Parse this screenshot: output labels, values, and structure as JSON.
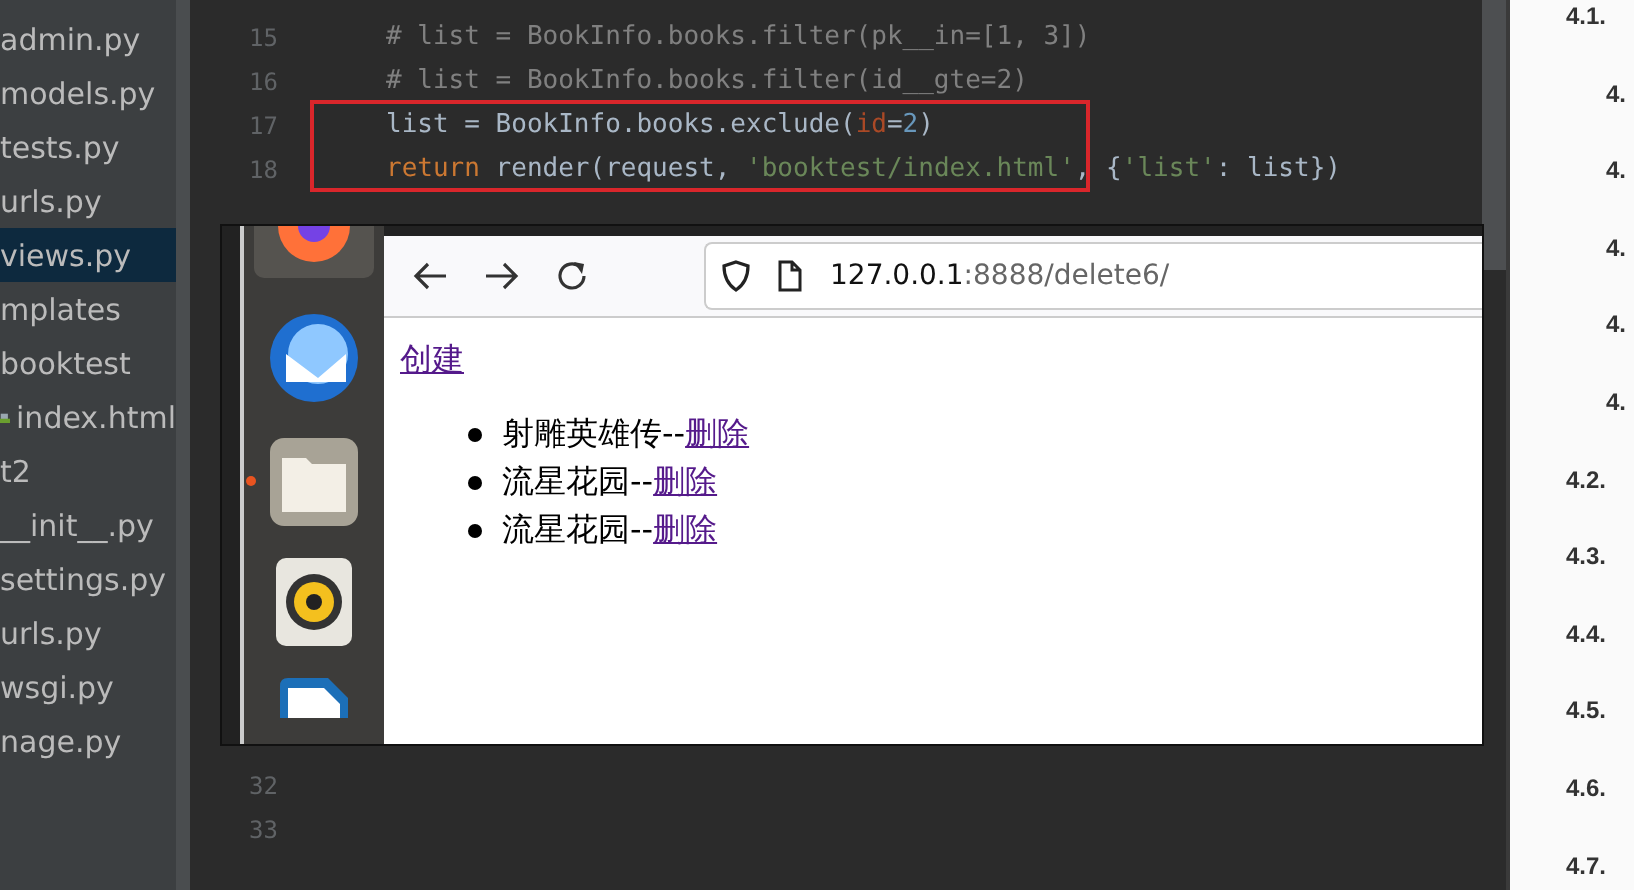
{
  "project_tree": {
    "items": [
      {
        "label": "admin.py",
        "selected": false,
        "kind": "file"
      },
      {
        "label": "models.py",
        "selected": false,
        "kind": "file"
      },
      {
        "label": "tests.py",
        "selected": false,
        "kind": "file"
      },
      {
        "label": "urls.py",
        "selected": false,
        "kind": "file"
      },
      {
        "label": "views.py",
        "selected": true,
        "kind": "file"
      },
      {
        "label": "mplates",
        "selected": false,
        "kind": "file"
      },
      {
        "label": "booktest",
        "selected": false,
        "kind": "file"
      },
      {
        "label": "index.html",
        "selected": false,
        "kind": "html"
      },
      {
        "label": "t2",
        "selected": false,
        "kind": "file"
      },
      {
        "label": "__init__.py",
        "selected": false,
        "kind": "file"
      },
      {
        "label": "settings.py",
        "selected": false,
        "kind": "file"
      },
      {
        "label": "urls.py",
        "selected": false,
        "kind": "file"
      },
      {
        "label": "wsgi.py",
        "selected": false,
        "kind": "file"
      },
      {
        "label": "nage.py",
        "selected": false,
        "kind": "file"
      }
    ]
  },
  "editor": {
    "lines": [
      {
        "number": "15",
        "tokens": [
          {
            "text": "# list = BookInfo.books.filter(pk__in=[1, 3])",
            "kind": "comment"
          }
        ]
      },
      {
        "number": "16",
        "tokens": [
          {
            "text": "# list = BookInfo.books.filter(id__gte=2)",
            "kind": "comment"
          }
        ]
      },
      {
        "number": "17",
        "tokens": [
          {
            "text": "list = BookInfo.books.exclude(",
            "kind": "plain"
          },
          {
            "text": "id",
            "kind": "param"
          },
          {
            "text": "=",
            "kind": "plain"
          },
          {
            "text": "2",
            "kind": "number"
          },
          {
            "text": ")",
            "kind": "plain"
          }
        ]
      },
      {
        "number": "18",
        "tokens": [
          {
            "text": "return",
            "kind": "keyword"
          },
          {
            "text": " render(request, ",
            "kind": "plain"
          },
          {
            "text": "'booktest/index.html'",
            "kind": "string"
          },
          {
            "text": ", {",
            "kind": "plain"
          },
          {
            "text": "'list'",
            "kind": "string"
          },
          {
            "text": ": list})",
            "kind": "plain"
          }
        ]
      },
      {
        "number": "32"
      },
      {
        "number": "33"
      }
    ]
  },
  "browser": {
    "url_host": "127.0.0.1",
    "url_rest": ":8888/delete6/",
    "create_link": "创建",
    "books": [
      {
        "title": "射雕英雄传--",
        "action": "删除"
      },
      {
        "title": "流星花园--",
        "action": "删除"
      },
      {
        "title": "流星花园--",
        "action": "删除"
      }
    ]
  },
  "dock": {
    "apps": [
      {
        "kind": "firefox",
        "running": false
      },
      {
        "kind": "mail",
        "running": false
      },
      {
        "kind": "files",
        "running": true
      },
      {
        "kind": "speaker",
        "running": false
      },
      {
        "kind": "writer",
        "running": false
      }
    ]
  },
  "toc": {
    "items": [
      {
        "label": "4.1.",
        "children": [
          {
            "label": "4."
          },
          {
            "label": "4."
          },
          {
            "label": "4."
          },
          {
            "label": "4."
          },
          {
            "label": "4."
          }
        ]
      },
      {
        "label": "4.2."
      },
      {
        "label": "4.3."
      },
      {
        "label": "4.4."
      },
      {
        "label": "4.5."
      },
      {
        "label": "4.6."
      },
      {
        "label": "4.7."
      }
    ]
  }
}
